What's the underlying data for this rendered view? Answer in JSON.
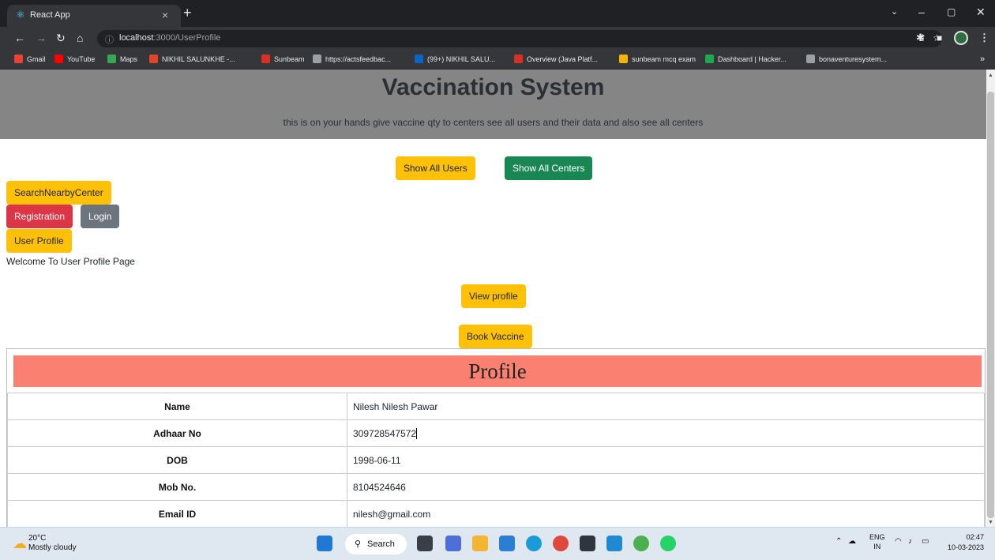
{
  "browser": {
    "tab_title": "React App",
    "tab_close": "×",
    "new_tab": "+",
    "url_host": "localhost",
    "url_path": ":3000/UserProfile",
    "bookmarks": [
      {
        "label": "Gmail",
        "color": "#ea4335"
      },
      {
        "label": "YouTube",
        "color": "#ff0000"
      },
      {
        "label": "Maps",
        "color": "#34a853"
      },
      {
        "label": "NIKHIL SALUNKHE -...",
        "color": "#e24329"
      },
      {
        "label": "Sunbeam",
        "color": "#d93025"
      },
      {
        "label": "https://actsfeedbac...",
        "color": "#9aa0a6"
      },
      {
        "label": "(99+) NIKHIL SALU...",
        "color": "#0a66c2"
      },
      {
        "label": "Overview (Java Platf...",
        "color": "#d93025"
      },
      {
        "label": "sunbeam mcq exam",
        "color": "#f4b400"
      },
      {
        "label": "Dashboard | Hacker...",
        "color": "#1ba94c"
      },
      {
        "label": "bonaventuresystem...",
        "color": "#9aa0a6"
      }
    ],
    "bookmarks_more": "»"
  },
  "header": {
    "title": "Vaccination System",
    "subtitle": "this is on your hands give vaccine qty to centers see all users and their data and also see all centers"
  },
  "nav": {
    "show_all_users": "Show All Users",
    "show_all_centers": "Show All Centers",
    "search_nearby": "SearchNearbyCenter",
    "registration": "Registration",
    "login": "Login",
    "user_profile": "User Profile"
  },
  "welcome": "Welcome To User Profile Page",
  "actions": {
    "view_profile": "View profile",
    "book_vaccine": "Book Vaccine"
  },
  "profile": {
    "heading": "Profile",
    "rows": [
      {
        "label": "Name",
        "value": "Nilesh Nilesh Pawar"
      },
      {
        "label": "Adhaar No",
        "value": "309728547572"
      },
      {
        "label": "DOB",
        "value": "1998-06-11"
      },
      {
        "label": "Mob No.",
        "value": "8104524646"
      },
      {
        "label": "Email ID",
        "value": "nilesh@gmail.com"
      }
    ]
  },
  "taskbar": {
    "temperature": "20°C",
    "weather": "Mostly cloudy",
    "search": "Search",
    "lang1": "ENG",
    "lang2": "IN",
    "time": "02:47",
    "date": "10-03-2023"
  },
  "colors": {
    "hero_bg": "#858585",
    "profile_head_bg": "#fa8072",
    "warning": "#ffc107",
    "success": "#198754",
    "danger": "#dc3545",
    "secondary": "#6c757d"
  }
}
